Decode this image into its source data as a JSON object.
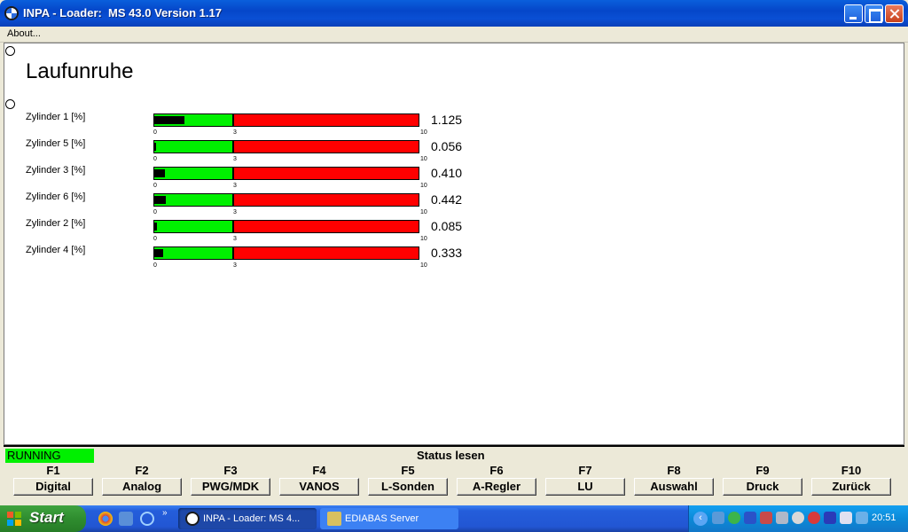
{
  "window": {
    "title": "INPA - Loader:  MS 43.0 Version 1.17"
  },
  "menu": {
    "about": "About..."
  },
  "page": {
    "title": "Laufunruhe"
  },
  "scale": {
    "min_label": "0",
    "mid_label": "3",
    "max_label": "10",
    "min": 0,
    "threshold": 3,
    "max": 10
  },
  "cylinders": [
    {
      "label": "Zylinder 1 [%]",
      "value": "1.125",
      "numeric": 1.125
    },
    {
      "label": "Zylinder 5 [%]",
      "value": "0.056",
      "numeric": 0.056
    },
    {
      "label": "Zylinder 3 [%]",
      "value": "0.410",
      "numeric": 0.41
    },
    {
      "label": "Zylinder 6 [%]",
      "value": "0.442",
      "numeric": 0.442
    },
    {
      "label": "Zylinder 2 [%]",
      "value": "0.085",
      "numeric": 0.085
    },
    {
      "label": "Zylinder 4 [%]",
      "value": "0.333",
      "numeric": 0.333
    }
  ],
  "status": {
    "state": "RUNNING",
    "text": "Status lesen"
  },
  "fkeys": [
    {
      "key": "F1",
      "label": "Digital"
    },
    {
      "key": "F2",
      "label": "Analog"
    },
    {
      "key": "F3",
      "label": "PWG/MDK"
    },
    {
      "key": "F4",
      "label": "VANOS"
    },
    {
      "key": "F5",
      "label": "L-Sonden"
    },
    {
      "key": "F6",
      "label": "A-Regler"
    },
    {
      "key": "F7",
      "label": "LU"
    },
    {
      "key": "F8",
      "label": "Auswahl"
    },
    {
      "key": "F9",
      "label": "Druck"
    },
    {
      "key": "F10",
      "label": "Zurück"
    }
  ],
  "taskbar": {
    "start": "Start",
    "more": "»",
    "tasks": [
      {
        "label": "INPA - Loader:  MS 4...",
        "icon": "bmw-logo-icon",
        "active": true
      },
      {
        "label": "EDIABAS Server",
        "icon": "ediabas-icon",
        "active": false
      }
    ],
    "tray_arrow": "‹",
    "clock": "20:51"
  },
  "colors": {
    "bar_ok": "#00f000",
    "bar_bad": "#ff0000",
    "running": "#00f000"
  }
}
